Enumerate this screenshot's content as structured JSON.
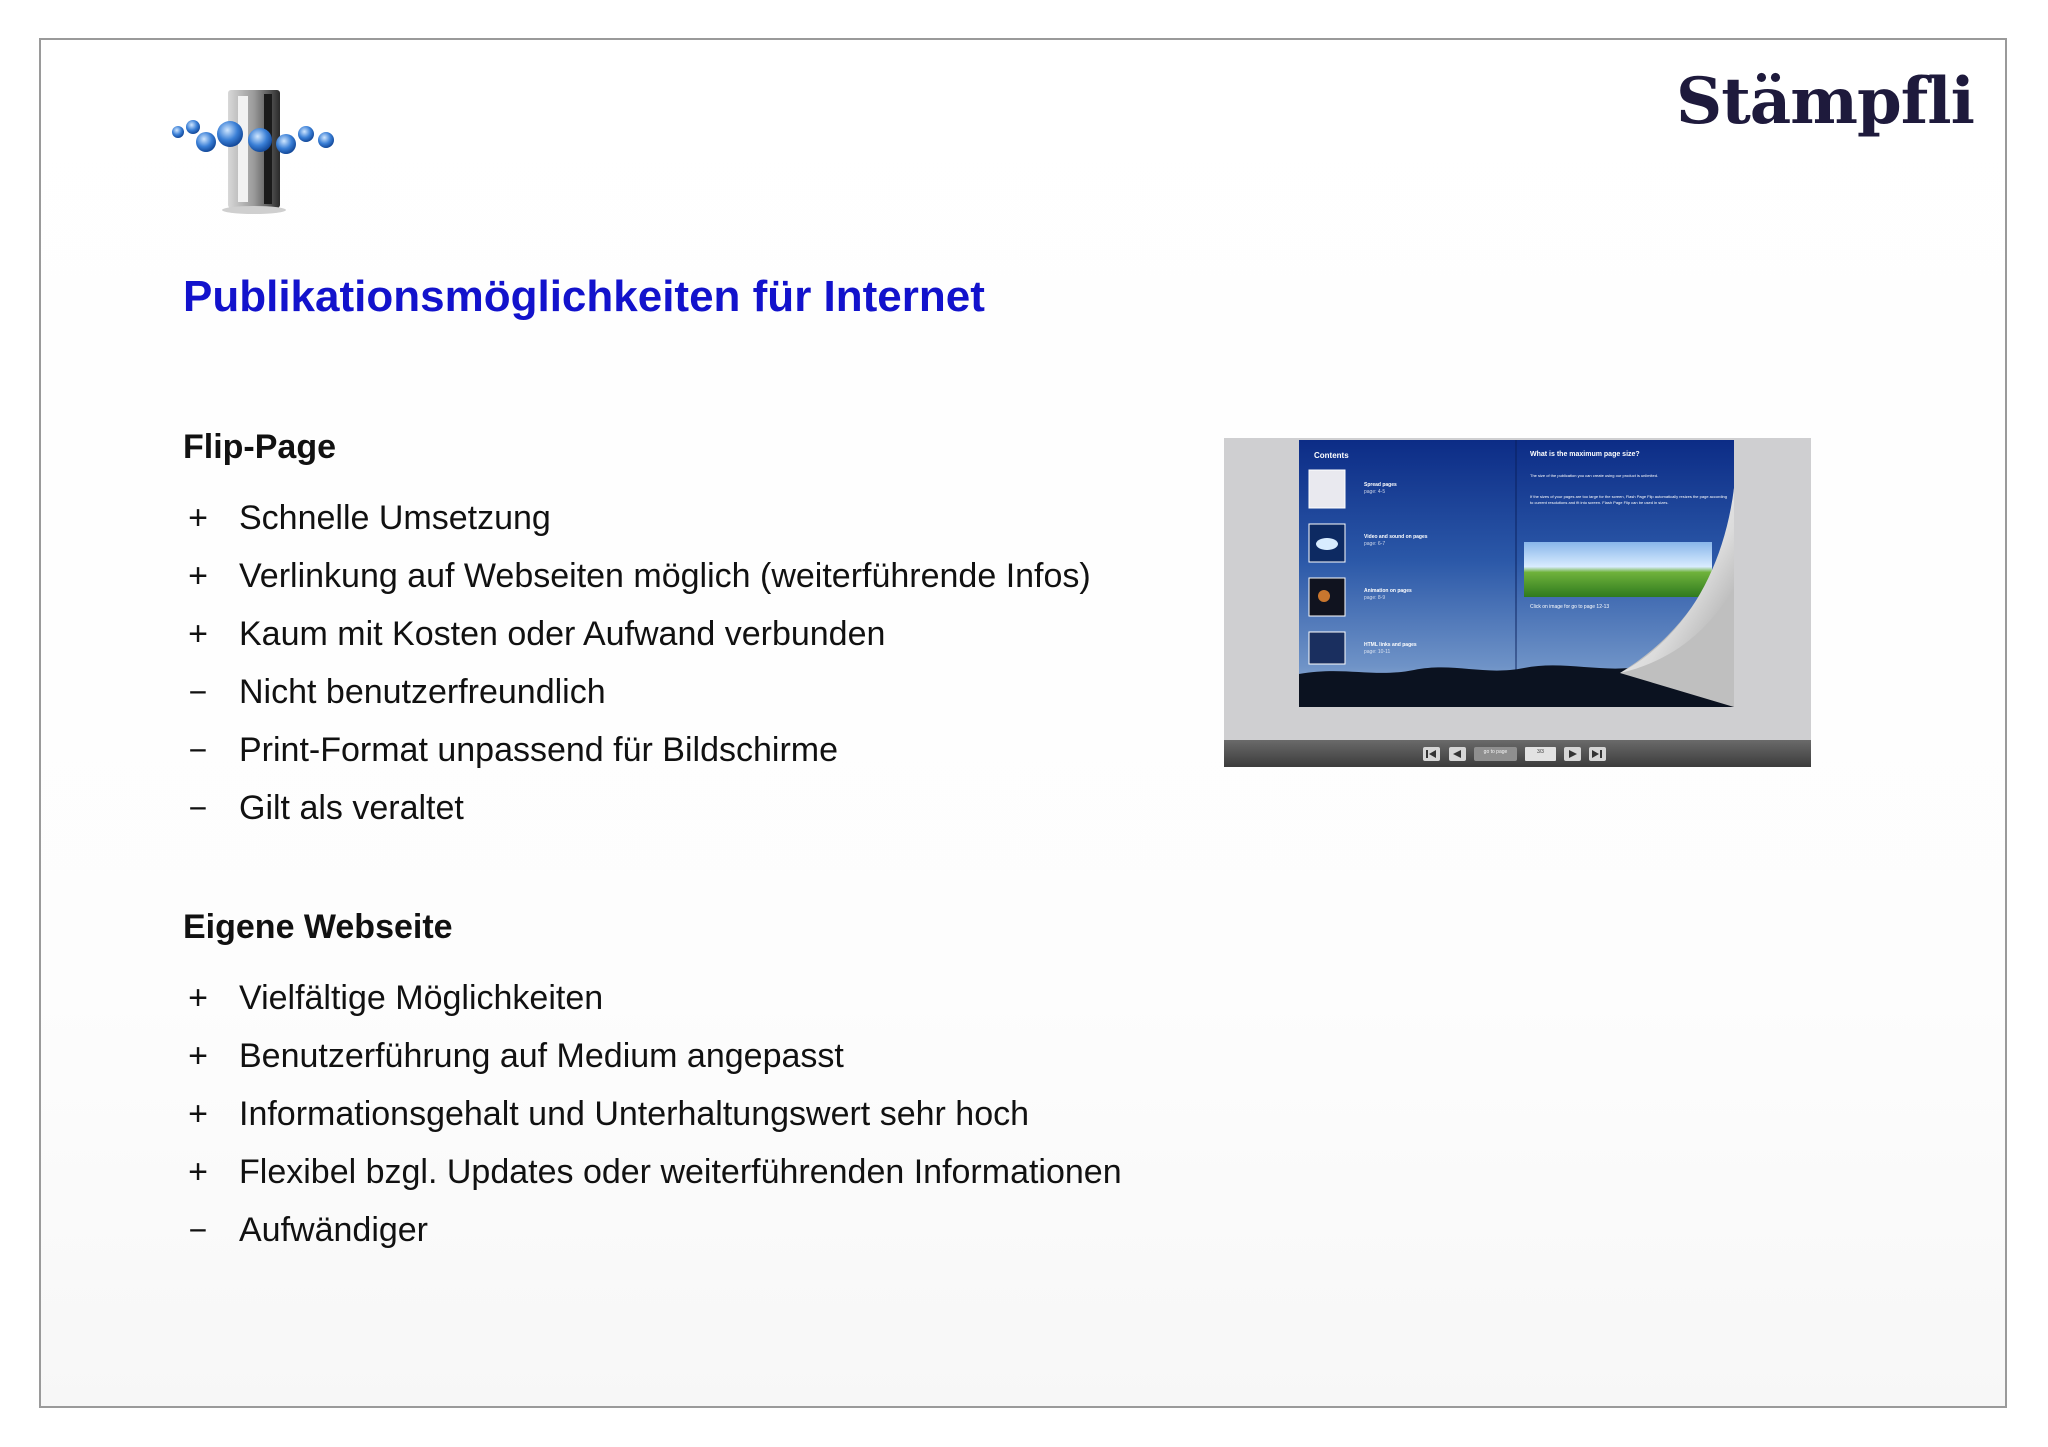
{
  "brand": {
    "text": "Stämpfli"
  },
  "title": "Publikationsmöglichkeiten für Internet",
  "sections": [
    {
      "heading": "Flip-Page",
      "items": [
        {
          "bullet": "+",
          "text": "Schnelle Umsetzung"
        },
        {
          "bullet": "+",
          "text": "Verlinkung auf Webseiten möglich (weiterführende Infos)"
        },
        {
          "bullet": "+",
          "text": "Kaum mit Kosten oder Aufwand verbunden"
        },
        {
          "bullet": "−",
          "text": "Nicht benutzerfreundlich"
        },
        {
          "bullet": "−",
          "text": "Print-Format unpassend für Bildschirme"
        },
        {
          "bullet": "−",
          "text": "Gilt als veraltet"
        }
      ]
    },
    {
      "heading": "Eigene Webseite",
      "items": [
        {
          "bullet": "+",
          "text": "Vielfältige Möglichkeiten"
        },
        {
          "bullet": "+",
          "text": "Benutzerführung auf Medium angepasst"
        },
        {
          "bullet": "+",
          "text": "Informationsgehalt und Unterhaltungswert sehr hoch"
        },
        {
          "bullet": "+",
          "text": "Flexibel bzgl. Updates oder weiterführenden Informationen"
        },
        {
          "bullet": "−",
          "text": "Aufwändiger"
        }
      ]
    }
  ],
  "flipbook": {
    "left_heading": "Contents",
    "toc": [
      {
        "title": "Spread pages",
        "sub": "page: 4-5"
      },
      {
        "title": "Video and sound on pages",
        "sub": "page: 6-7"
      },
      {
        "title": "Animation on pages",
        "sub": "page: 8-9"
      },
      {
        "title": "HTML links and pages",
        "sub": "page: 10-11"
      }
    ],
    "right_heading": "What is the maximum page size?",
    "right_text_1": "The size of the publication you can create using our product is unlimited.",
    "right_text_2": "If the sizes of your pages are too large for the screen, Flash Page Flip automatically resizes the page according to current resolutions and fit into screen. Flash Page Flip can be used in sizes.",
    "right_caption": "Click on image for go to page 12-13",
    "nav_goto": "go to page",
    "nav_page": "3/3"
  },
  "colors": {
    "title": "#1212cc",
    "text": "#111111",
    "border": "#9a9a9a"
  },
  "icons": [
    "device-apps-icon",
    "first-page-icon",
    "prev-page-icon",
    "next-page-icon",
    "last-page-icon"
  ]
}
